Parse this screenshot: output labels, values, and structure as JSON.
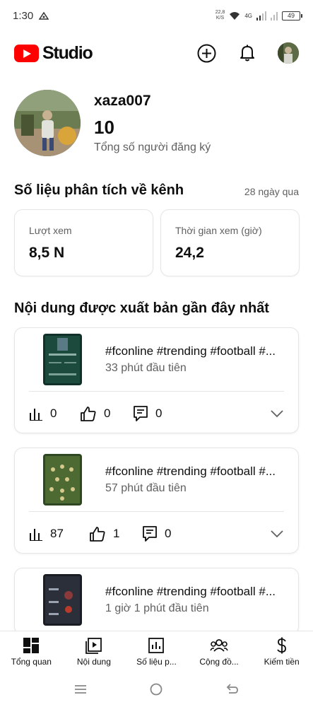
{
  "status_bar": {
    "time": "1:30",
    "net_speed_value": "22,8",
    "net_speed_unit": "K/S",
    "network": "4G",
    "battery": "49"
  },
  "app": {
    "title": "Studio"
  },
  "channel": {
    "name": "xaza007",
    "subscriber_count": "10",
    "subscriber_label": "Tổng số người đăng ký"
  },
  "analytics": {
    "title": "Số liệu phân tích về kênh",
    "period": "28 ngày qua",
    "stats": [
      {
        "label": "Lượt xem",
        "value": "8,5 N"
      },
      {
        "label": "Thời gian xem (giờ)",
        "value": "24,2"
      }
    ]
  },
  "recent": {
    "title": "Nội dung được xuất bản gần đây nhất",
    "videos": [
      {
        "title": "#fconline #trending #football #...",
        "time": "33 phút đầu tiên",
        "views": "0",
        "likes": "0",
        "comments": "0"
      },
      {
        "title": "#fconline #trending #football #...",
        "time": "57 phút đầu tiên",
        "views": "87",
        "likes": "1",
        "comments": "0"
      },
      {
        "title": "#fconline #trending #football #...",
        "time": "1 giờ 1 phút đầu tiên",
        "views": "",
        "likes": "",
        "comments": ""
      }
    ]
  },
  "bottom_nav": {
    "items": [
      {
        "label": "Tổng quan",
        "icon": "dashboard-icon"
      },
      {
        "label": "Nội dung",
        "icon": "content-icon"
      },
      {
        "label": "Số liệu p...",
        "icon": "analytics-icon"
      },
      {
        "label": "Cộng đồ...",
        "icon": "community-icon"
      },
      {
        "label": "Kiếm tiền",
        "icon": "earn-icon"
      }
    ]
  },
  "colors": {
    "brand": "#ff0000",
    "text_primary": "#0f0f0f",
    "text_secondary": "#606060",
    "border": "#e5e5e5"
  }
}
